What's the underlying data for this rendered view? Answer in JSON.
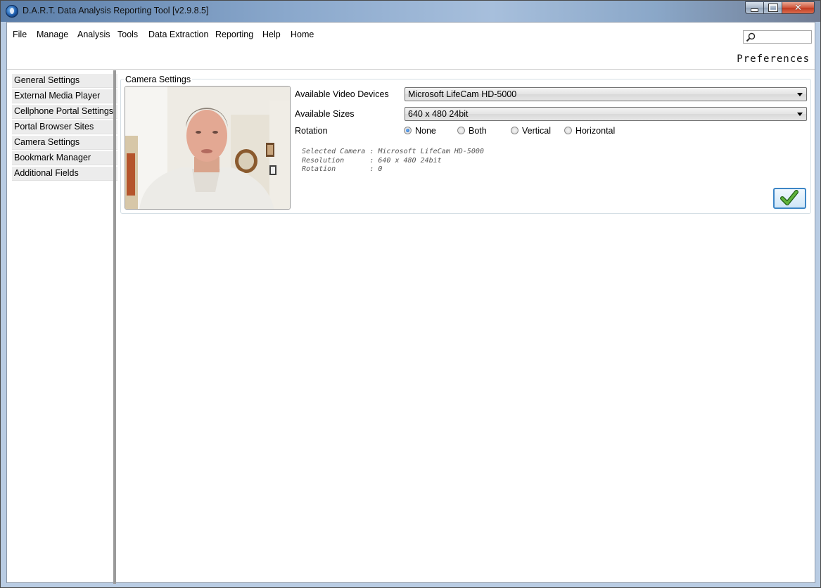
{
  "window": {
    "title": "D.A.R.T. Data Analysis Reporting Tool [v2.9.8.5]",
    "buttons": [
      "minimize",
      "maximize",
      "close"
    ]
  },
  "menu": {
    "items": [
      "File",
      "Manage",
      "Analysis",
      "Tools",
      "Data Extraction",
      "Reporting",
      "Help",
      "Home"
    ]
  },
  "search": {
    "placeholder": ""
  },
  "page": {
    "title": "Preferences"
  },
  "sidebar": {
    "items": [
      {
        "label": "General Settings"
      },
      {
        "label": "External Media Player"
      },
      {
        "label": "Cellphone Portal Settings"
      },
      {
        "label": "Portal Browser Sites"
      },
      {
        "label": "Camera Settings"
      },
      {
        "label": "Bookmark Manager"
      },
      {
        "label": "Additional Fields"
      }
    ]
  },
  "camera": {
    "group_label": "Camera Settings",
    "devices_label": "Available Video Devices",
    "devices_value": "Microsoft LifeCam HD-5000",
    "sizes_label": "Available Sizes",
    "sizes_value": "640 x 480 24bit",
    "rotation_label": "Rotation",
    "rotation_options": [
      "None",
      "Both",
      "Vertical",
      "Horizontal"
    ],
    "rotation_selected": "None",
    "info": {
      "camera_line": "Selected Camera : Microsoft LifeCam HD-5000",
      "resolution_line": "Resolution      : 640 x 480 24bit",
      "rotation_line": "Rotation        : 0"
    }
  },
  "colors": {
    "ok_border": "#3d86c6",
    "checkmark": "#3f8f2a"
  }
}
